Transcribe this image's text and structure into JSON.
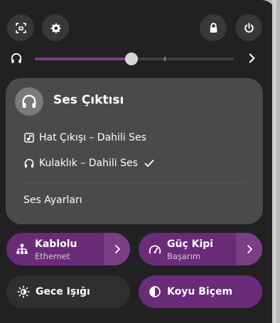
{
  "top_row": {
    "screenshot_icon": "screenshot-icon",
    "settings_icon": "gear-icon",
    "lock_icon": "lock-icon",
    "power_icon": "power-icon"
  },
  "volume": {
    "icon": "headphones-icon",
    "level_fraction": 0.485,
    "arrow_icon": "chevron-right-icon"
  },
  "sound_output": {
    "title": "Ses Çıktısı",
    "items": [
      {
        "label": "Hat Çıkışı – Dahili Ses",
        "icon": "line-out-icon",
        "selected": false
      },
      {
        "label": "Kulaklık – Dahili Ses",
        "icon": "headphones-icon",
        "selected": true
      }
    ],
    "settings_label": "Ses Ayarları"
  },
  "toggles": {
    "wired": {
      "title": "Kablolu",
      "subtitle": "Ethernet",
      "active": true
    },
    "power_mode": {
      "title": "Güç Kipi",
      "subtitle": "Başarım",
      "active": true
    },
    "night_light": {
      "title": "Gece Işığı",
      "active": false
    },
    "dark_style": {
      "title": "Koyu Biçem",
      "active": true
    }
  },
  "colors": {
    "accent": "#6a2b78",
    "accent_light": "#7a3e86",
    "panel_bg": "#212121",
    "submenu_bg": "#4a4a4a"
  }
}
